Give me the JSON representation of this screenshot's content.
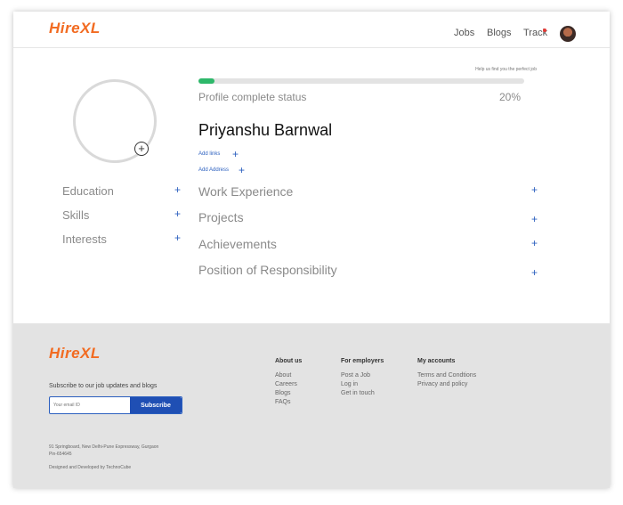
{
  "header": {
    "brand": "HireXL",
    "nav": {
      "jobs": "Jobs",
      "blogs": "Blogs",
      "track": "Track"
    },
    "avatar_icon": "user-avatar"
  },
  "profile": {
    "progress_hint": "Help us find you the perfect job",
    "progress_percent": 20,
    "status_label": "Profile complete status",
    "status_value": "20%",
    "name": "Priyanshu Barnwal",
    "add_links": "Add links",
    "add_address": "Add Address",
    "plus": "+"
  },
  "left_sections": [
    {
      "label": "Education"
    },
    {
      "label": "Skills"
    },
    {
      "label": "Interests"
    }
  ],
  "main_sections": [
    {
      "label": "Work Experience"
    },
    {
      "label": "Projects"
    },
    {
      "label": "Achievements"
    },
    {
      "label": "Position of Responsibility"
    }
  ],
  "footer": {
    "brand": "HireXL",
    "subscribe_text": "Subscribe to our job updates and blogs",
    "email_placeholder": "Your email ID",
    "subscribe_button": "Subscribe",
    "address_line1": "91 Springboard, New Delhi-Pune Expressway, Gurgaon",
    "address_line2": "Pin-654645",
    "designed": "Designed and Developed by TechnoCube",
    "columns": [
      {
        "title": "About us",
        "links": [
          "About",
          "Careers",
          "Blogs",
          "FAQs"
        ]
      },
      {
        "title": "For employers",
        "links": [
          "Post a Job",
          "Log in",
          "Get in touch"
        ]
      },
      {
        "title": "My accounts",
        "links": [
          "Terms and Condtions",
          "Privacy and policy"
        ]
      }
    ]
  },
  "colors": {
    "brand": "#f26b21",
    "accent": "#2b5fbf",
    "progress": "#2eb86a",
    "footer_bg": "#e3e3e3"
  }
}
